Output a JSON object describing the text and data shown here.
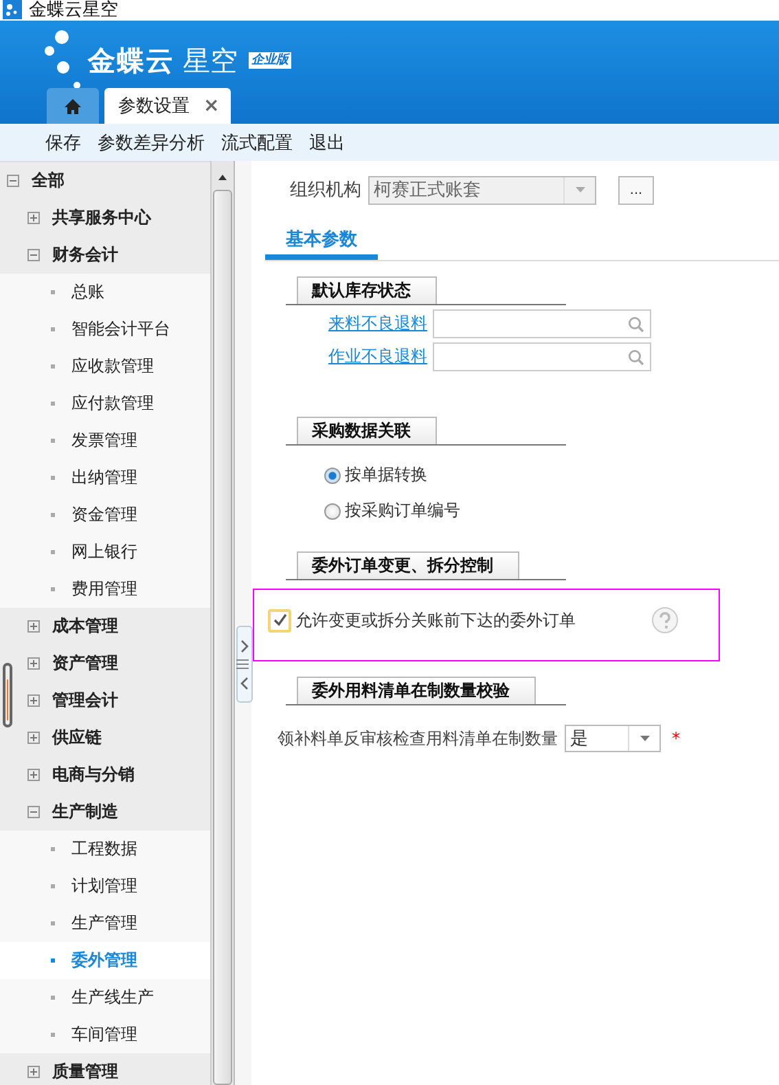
{
  "window": {
    "title": "金蝶云星空"
  },
  "logo": {
    "name": "金蝶云",
    "product": "星空",
    "edition": "企业版"
  },
  "tabs": [
    {
      "kind": "home",
      "selected": false
    },
    {
      "kind": "page",
      "label": "参数设置",
      "close": "×",
      "selected": true
    }
  ],
  "toolbar": [
    "保存",
    "参数差异分析",
    "流式配置",
    "退出"
  ],
  "tree": [
    {
      "label": "全部",
      "expanded": true,
      "selected": false,
      "children": [
        {
          "label": "共享服务中心",
          "expanded": false,
          "selected": false
        },
        {
          "label": "财务会计",
          "expanded": true,
          "selected": false,
          "children": [
            {
              "label": "总账",
              "selected": false
            },
            {
              "label": "智能会计平台",
              "selected": false
            },
            {
              "label": "应收款管理",
              "selected": false
            },
            {
              "label": "应付款管理",
              "selected": false
            },
            {
              "label": "发票管理",
              "selected": false
            },
            {
              "label": "出纳管理",
              "selected": false
            },
            {
              "label": "资金管理",
              "selected": false
            },
            {
              "label": "网上银行",
              "selected": false
            },
            {
              "label": "费用管理",
              "selected": false
            }
          ]
        },
        {
          "label": "成本管理",
          "expanded": false,
          "selected": false
        },
        {
          "label": "资产管理",
          "expanded": false,
          "selected": false
        },
        {
          "label": "管理会计",
          "expanded": false,
          "selected": false
        },
        {
          "label": "供应链",
          "expanded": false,
          "selected": false
        },
        {
          "label": "电商与分销",
          "expanded": false,
          "selected": false
        },
        {
          "label": "生产制造",
          "expanded": true,
          "selected": false,
          "children": [
            {
              "label": "工程数据",
              "selected": false
            },
            {
              "label": "计划管理",
              "selected": false
            },
            {
              "label": "生产管理",
              "selected": false
            },
            {
              "label": "委外管理",
              "selected": true
            },
            {
              "label": "生产线生产",
              "selected": false
            },
            {
              "label": "车间管理",
              "selected": false
            }
          ]
        },
        {
          "label": "质量管理",
          "expanded": false,
          "selected": false
        }
      ]
    }
  ],
  "org": {
    "label": "组织机构",
    "value": "柯赛正式账套",
    "disabled": true,
    "more": "..."
  },
  "section_tabs": [
    {
      "label": "基本参数",
      "selected": true
    }
  ],
  "groups": [
    {
      "title": "默认库存状态",
      "highlighted": false,
      "items": [
        {
          "kind": "lookup",
          "label": "来料不良退料"
        },
        {
          "kind": "lookup",
          "label": "作业不良退料"
        }
      ]
    },
    {
      "title": "采购数据关联",
      "highlighted": false,
      "items": [
        {
          "kind": "radio",
          "label": "按单据转换",
          "selected": true
        },
        {
          "kind": "radio",
          "label": "按采购订单编号",
          "selected": false
        }
      ]
    },
    {
      "title": "委外订单变更、拆分控制",
      "highlighted": true,
      "items": [
        {
          "kind": "checkbox",
          "label": "允许变更或拆分关账前下达的委外订单",
          "checked": true
        }
      ]
    },
    {
      "title": "委外用料清单在制数量校验",
      "highlighted": false,
      "items": [
        {
          "kind": "select",
          "label": "领补料单反审核检查用料清单在制数量",
          "value": "是",
          "required_mark": "*"
        }
      ]
    }
  ]
}
